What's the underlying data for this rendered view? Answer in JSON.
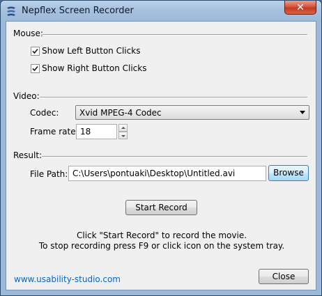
{
  "window": {
    "title": "Nepflex Screen Recorder",
    "close_glyph": "✕"
  },
  "icons": {
    "app": "app-logo-icon",
    "check": "checkmark-icon"
  },
  "mouse": {
    "label": "Mouse:",
    "options": [
      {
        "label": "Show Left Button Clicks",
        "checked": true
      },
      {
        "label": "Show Right Button Clicks",
        "checked": true
      }
    ]
  },
  "video": {
    "label": "Video:",
    "codec_label": "Codec:",
    "codec_value": "Xvid MPEG-4 Codec",
    "framerate_label": "Frame rate:",
    "framerate_value": "18"
  },
  "result": {
    "label": "Result:",
    "filepath_label": "File Path:",
    "filepath_value": "C:\\Users\\pontuaki\\Desktop\\Untitled.avi",
    "browse_label": "Browse"
  },
  "start_label": "Start Record",
  "instructions": [
    "Click \"Start Record\" to record the movie.",
    "To stop recording press F9 or click icon on the system tray."
  ],
  "footer": {
    "link": "www.usability-studio.com",
    "close_label": "Close"
  },
  "colors": {
    "link": "#0066cc",
    "titlebar": "#a8c2df",
    "close": "#c23a20"
  }
}
